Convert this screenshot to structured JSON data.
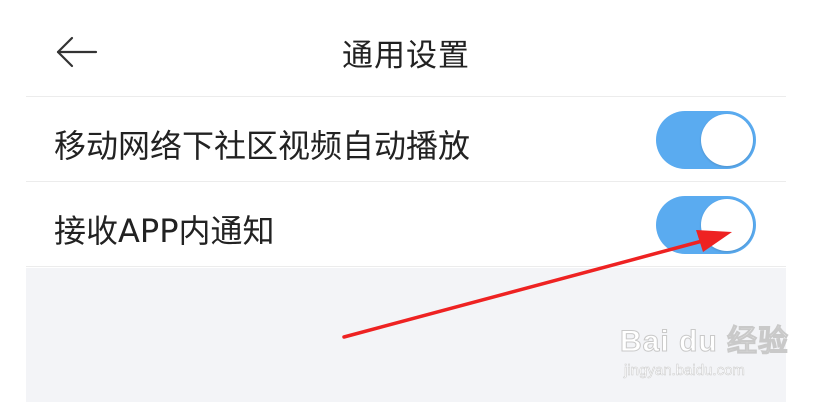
{
  "header": {
    "title": "通用设置",
    "back_icon": "arrow-left-icon"
  },
  "settings": [
    {
      "label": "移动网络下社区视频自动播放",
      "enabled": true
    },
    {
      "label": "接收APP内通知",
      "enabled": true
    }
  ],
  "colors": {
    "toggle_on": "#5aabf0",
    "annotation_arrow": "#ee2222",
    "background_gray": "#f3f4f7"
  },
  "watermark": {
    "logo": "Bai du 经验",
    "url": "jingyan.baidu.com"
  }
}
